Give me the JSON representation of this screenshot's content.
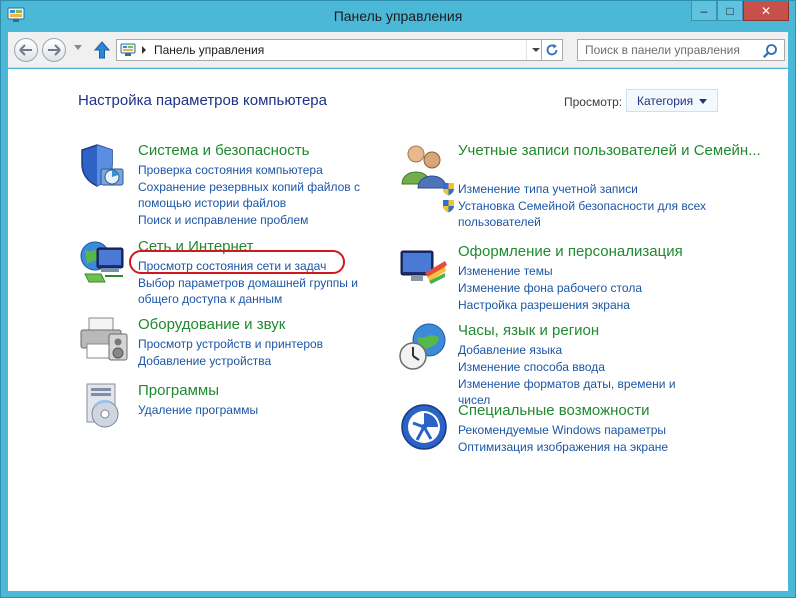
{
  "window": {
    "title": "Панель управления"
  },
  "controls": {
    "minimize": "–",
    "maximize": "□",
    "close": "✕"
  },
  "address": {
    "path": "Панель управления"
  },
  "search": {
    "placeholder": "Поиск в панели управления"
  },
  "page": {
    "heading": "Настройка параметров компьютера",
    "view_label": "Просмотр:",
    "view_value": "Категория"
  },
  "categories": [
    {
      "title": "Система и безопасность",
      "icon": "shield-icon",
      "links": [
        "Проверка состояния компьютера",
        "Сохранение резервных копий файлов с помощью истории файлов",
        "Поиск и исправление проблем"
      ]
    },
    {
      "title": "Сеть и Интернет",
      "icon": "network-icon",
      "links": [
        "Просмотр состояния сети и задач",
        "Выбор параметров домашней группы и общего доступа к данным"
      ]
    },
    {
      "title": "Оборудование и звук",
      "icon": "printer-icon",
      "links": [
        "Просмотр устройств и принтеров",
        "Добавление устройства"
      ]
    },
    {
      "title": "Программы",
      "icon": "programs-icon",
      "links": [
        "Удаление программы"
      ]
    },
    {
      "title": "Учетные записи пользователей и Семейн...",
      "icon": "users-icon",
      "links": [
        "Изменение типа учетной записи",
        "Установка Семейной безопасности для всех пользователей"
      ]
    },
    {
      "title": "Оформление и персонализация",
      "icon": "display-icon",
      "links": [
        "Изменение темы",
        "Изменение фона рабочего стола",
        "Настройка разрешения экрана"
      ]
    },
    {
      "title": "Часы, язык и регион",
      "icon": "clock-globe-icon",
      "links": [
        "Добавление языка",
        "Изменение способа ввода",
        "Изменение форматов даты, времени и чисел"
      ]
    },
    {
      "title": "Специальные возможности",
      "icon": "accessibility-icon",
      "links": [
        "Рекомендуемые Windows параметры",
        "Оптимизация изображения на экране"
      ]
    }
  ],
  "colors": {
    "title_bar": "#4cb8d8",
    "category_title": "#1f8a2e",
    "link": "#1b56a6",
    "heading": "#1e3287",
    "highlight": "#d0181f"
  }
}
